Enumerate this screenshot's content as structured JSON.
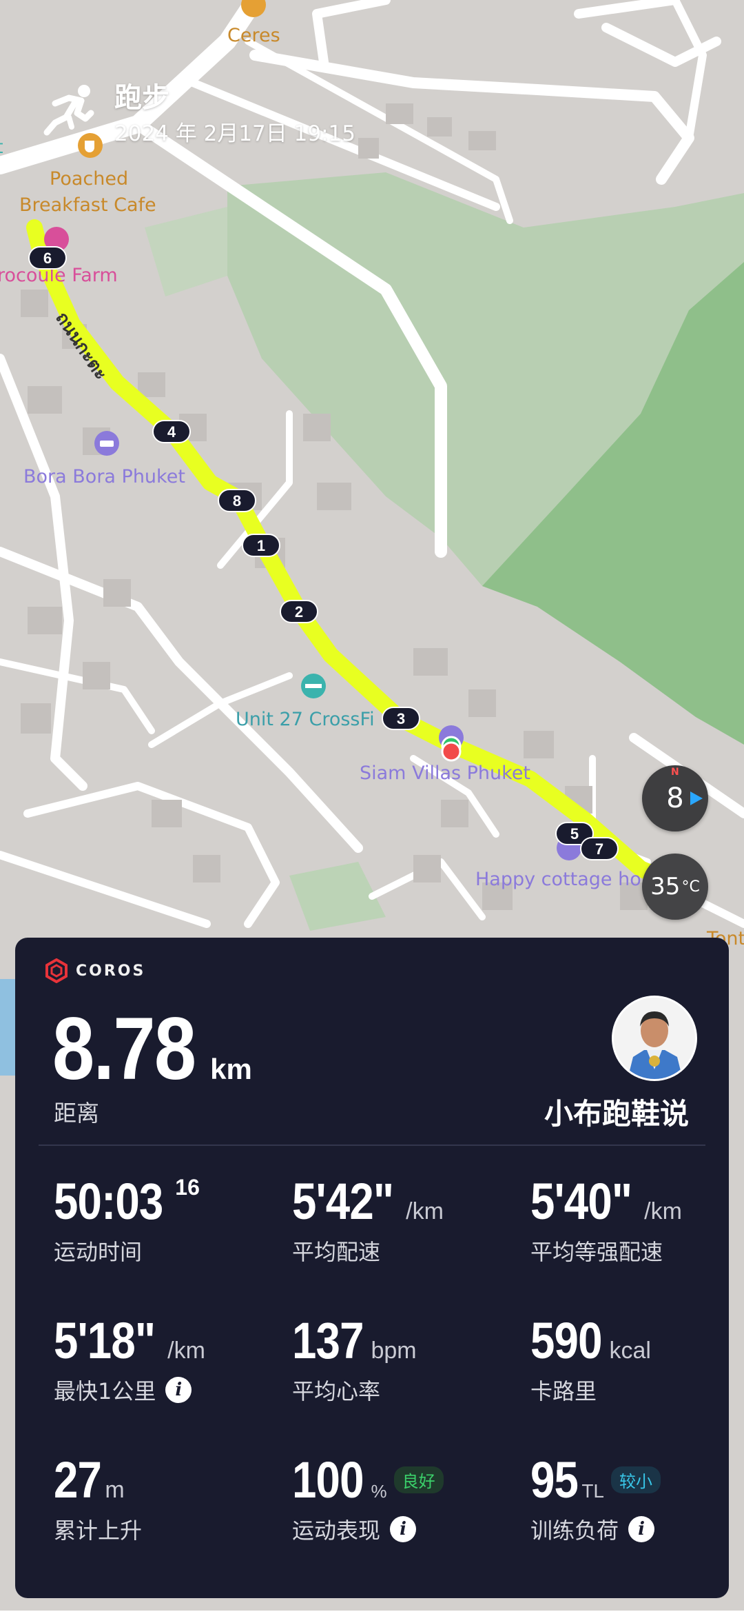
{
  "activity": {
    "title": "跑步",
    "datetime": "2024 年 2月17日 19:15",
    "icon": "runner-icon"
  },
  "map": {
    "pois": {
      "ceres": "Ceres",
      "poached_l1": "Poached",
      "poached_l2": "Breakfast Cafe",
      "farm": "rocoule Farm",
      "bora": "Bora Bora Phuket",
      "crossfit": "Unit 27 CrossFi",
      "siam": "Siam Villas Phuket",
      "happy": "Happy cottage ho",
      "tont": "Tont",
      "left_t": "t"
    },
    "road_label": "ถนนกะตะ",
    "km_markers": [
      "6",
      "4",
      "8",
      "1",
      "2",
      "3",
      "5",
      "7"
    ],
    "route_color": "#e8ff21"
  },
  "compass": {
    "value": "8",
    "north": "N"
  },
  "temperature": {
    "value": "35",
    "unit": "°C"
  },
  "panel": {
    "brand": "COROS",
    "distance": {
      "value": "8.78",
      "unit": "km",
      "label": "距离"
    },
    "author": "小布跑鞋说",
    "stats": {
      "time": {
        "value": "50:03",
        "sup": "16",
        "label": "运动时间"
      },
      "avg_pace": {
        "value": "5'42\"",
        "unit": "/km",
        "label": "平均配速"
      },
      "avg_grade_pace": {
        "value": "5'40\"",
        "unit": "/km",
        "label": "平均等强配速"
      },
      "fastest_km": {
        "value": "5'18\"",
        "unit": "/km",
        "label": "最快1公里"
      },
      "avg_hr": {
        "value": "137",
        "unit": "bpm",
        "label": "平均心率"
      },
      "calories": {
        "value": "590",
        "unit": "kcal",
        "label": "卡路里"
      },
      "ascent": {
        "value": "27",
        "unit": "m",
        "label": "累计上升"
      },
      "performance": {
        "value": "100",
        "unit": "%",
        "badge": "良好",
        "label": "运动表现"
      },
      "training_load": {
        "value": "95",
        "unit": "TL",
        "badge": "较小",
        "label": "训练负荷"
      }
    }
  },
  "colors": {
    "panel_bg": "#191b2e",
    "route": "#e8ff21",
    "green_area": "#8fbf8a",
    "good_badge": "#3bd06a",
    "low_badge": "#38c6e8"
  }
}
